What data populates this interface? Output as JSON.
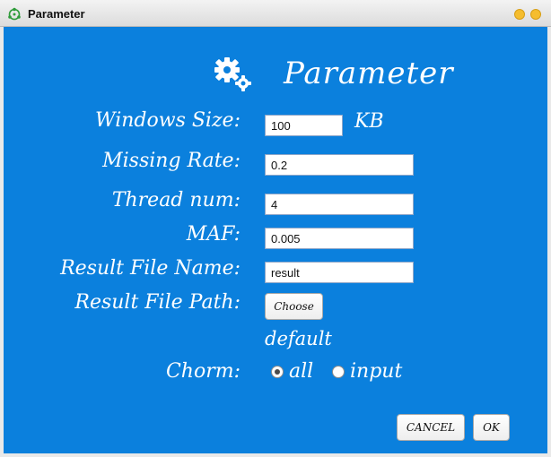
{
  "window": {
    "title": "Parameter"
  },
  "header": {
    "title": "Parameter"
  },
  "form": {
    "window_size": {
      "label": "Windows Size:",
      "value": "100",
      "unit": "KB"
    },
    "missing_rate": {
      "label": "Missing Rate:",
      "value": "0.2"
    },
    "thread_num": {
      "label": "Thread num:",
      "value": "4"
    },
    "maf": {
      "label": "MAF:",
      "value": "0.005"
    },
    "result_file_name": {
      "label": "Result File Name:",
      "value": "result"
    },
    "result_file_path": {
      "label": "Result File Path:",
      "button": "Choose",
      "current": "default"
    },
    "chorm": {
      "label": "Chorm:",
      "options": [
        {
          "label": "all",
          "checked": true
        },
        {
          "label": "input",
          "checked": false
        }
      ]
    }
  },
  "actions": {
    "cancel": "CANCEL",
    "ok": "OK"
  },
  "colors": {
    "background": "#0b80dd",
    "text": "#ffffff"
  }
}
